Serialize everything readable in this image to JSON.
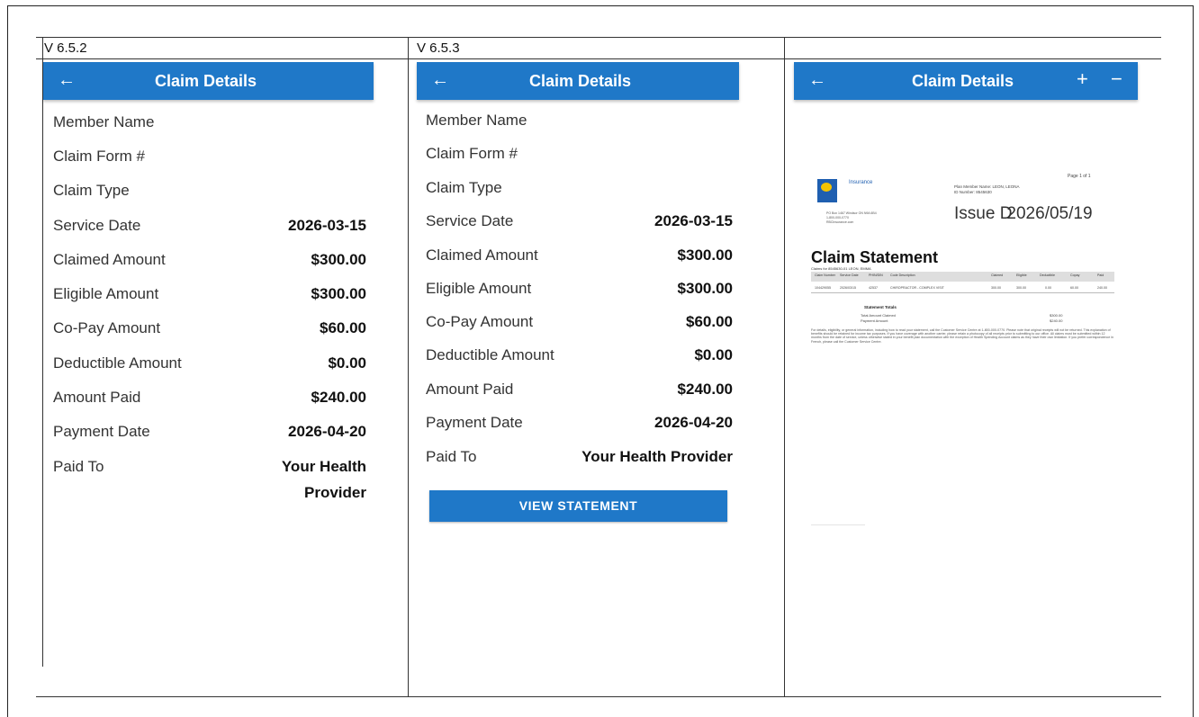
{
  "columns": [
    {
      "version": "V 6.5.2",
      "appbar": {
        "title": "Claim Details",
        "back_icon": "arrow-left-icon"
      },
      "fields": [
        {
          "label": "Member Name",
          "value": ""
        },
        {
          "label": "Claim Form #",
          "value": ""
        },
        {
          "label": "Claim Type",
          "value": ""
        },
        {
          "label": "Service Date",
          "value": "2026-03-15"
        },
        {
          "label": "Claimed Amount",
          "value": "$300.00"
        },
        {
          "label": "Eligible Amount",
          "value": "$300.00"
        },
        {
          "label": "Co-Pay Amount",
          "value": "$60.00"
        },
        {
          "label": "Deductible Amount",
          "value": "$0.00"
        },
        {
          "label": "Amount Paid",
          "value": "$240.00"
        },
        {
          "label": "Payment Date",
          "value": "2026-04-20"
        },
        {
          "label": "Paid To",
          "value": "Your Health Provider"
        }
      ]
    },
    {
      "version": "V 6.5.3",
      "appbar": {
        "title": "Claim Details",
        "back_icon": "arrow-left-icon"
      },
      "fields": [
        {
          "label": "Member Name",
          "value": ""
        },
        {
          "label": "Claim Form #",
          "value": ""
        },
        {
          "label": "Claim Type",
          "value": ""
        },
        {
          "label": "Service Date",
          "value": "2026-03-15"
        },
        {
          "label": "Claimed Amount",
          "value": "$300.00"
        },
        {
          "label": "Eligible Amount",
          "value": "$300.00"
        },
        {
          "label": "Co-Pay Amount",
          "value": "$60.00"
        },
        {
          "label": "Deductible Amount",
          "value": "$0.00"
        },
        {
          "label": "Amount Paid",
          "value": "$240.00"
        },
        {
          "label": "Payment Date",
          "value": "2026-04-20"
        },
        {
          "label": "Paid To",
          "value": "Your Health Provider"
        }
      ],
      "button_label": "VIEW STATEMENT"
    },
    {
      "version": "",
      "appbar": {
        "title": "Claim Details",
        "back_icon": "arrow-left-icon",
        "zoom_in_icon": "plus-icon",
        "zoom_out_icon": "minus-icon"
      },
      "statement": {
        "brand": "Insurance",
        "logo": "rbc-logo",
        "page": "Page 1 of 1",
        "member_name_label": "Plan Member Name: LEON, LEONA",
        "id_label": "ID Number:",
        "id_value": "8545630",
        "issue": "Issue D",
        "issue_date": "2026/05/19",
        "title": "Claim Statement",
        "claims_for": "Claims for 8545630-01 LEON, EMMA",
        "table_headers": [
          "Claim Number",
          "Service Date",
          "PHIN/DIN",
          "Code Description",
          "Claimed",
          "Eligible",
          "Deductible",
          "Copay",
          "Paid"
        ],
        "table_row": [
          "104429055",
          "2026/03/15",
          "42537",
          "CHIROPRACTOR - COMPLEX VISIT",
          "300.00",
          "300.00",
          "0.00",
          "60.00",
          "240.00"
        ],
        "totals_title": "Statement Totals",
        "total_claimed_label": "Total Amount Claimed",
        "total_claimed_value": "$300.00",
        "payment_label": "Payment Amount",
        "payment_value": "$240.00",
        "fine_print": "For details, eligibility, or general information, including how to read your statement, call the Customer Service Centre at 1-800-000-0770. Please note that original receipts will not be returned. This explanation of benefits should be retained for income tax purposes. If you have coverage with another carrier, please retain a photocopy of all receipts prior to submitting to our office. All claims must be submitted within 12 months from the date of service, unless otherwise stated in your benefit plan documentation with the exception of Health Spending Account claims as they have their own limitation. If you prefer correspondence in French, please call the Customer Service Centre."
      }
    }
  ]
}
